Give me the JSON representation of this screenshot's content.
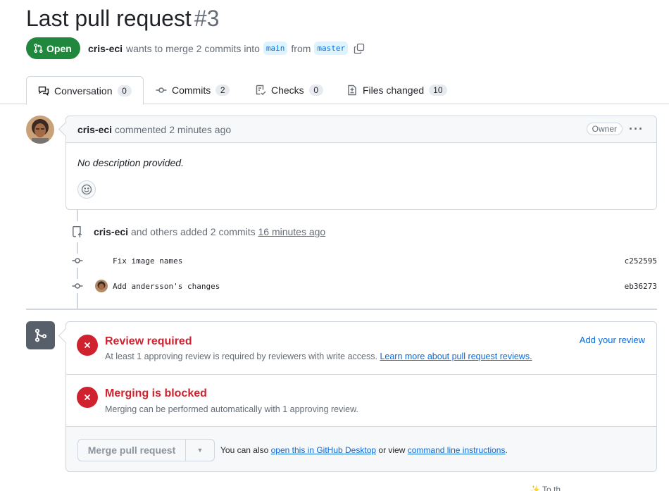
{
  "pr": {
    "title": "Last pull request",
    "number": "#3",
    "state": "Open",
    "author": "cris-eci",
    "merge_text": "wants to merge 2 commits into",
    "base_branch": "main",
    "from_text": "from",
    "head_branch": "master"
  },
  "tabs": [
    {
      "label": "Conversation",
      "count": "0",
      "icon": "comment-discussion-icon"
    },
    {
      "label": "Commits",
      "count": "2",
      "icon": "git-commit-icon"
    },
    {
      "label": "Checks",
      "count": "0",
      "icon": "checklist-icon"
    },
    {
      "label": "Files changed",
      "count": "10",
      "icon": "file-diff-icon"
    }
  ],
  "comment": {
    "author": "cris-eci",
    "action": "commented",
    "time": "2 minutes ago",
    "badge": "Owner",
    "menu": "···",
    "body": "No description provided."
  },
  "event": {
    "author": "cris-eci",
    "text": "and others added 2 commits",
    "time": "16 minutes ago"
  },
  "commits": [
    {
      "message": "Fix image names",
      "sha": "c252595"
    },
    {
      "message": "Add andersson's changes",
      "sha": "eb36273"
    }
  ],
  "merge": {
    "review_title": "Review required",
    "review_sub": "At least 1 approving review is required by reviewers with write access.",
    "review_link": "Learn more about pull request reviews.",
    "add_review": "Add your review",
    "blocked_title": "Merging is blocked",
    "blocked_sub": "Merging can be performed automatically with 1 approving review.",
    "button": "Merge pull request",
    "note_prefix": "You can also",
    "note_link1": "open this in GitHub Desktop",
    "note_mid": "or view",
    "note_link2": "command line instructions",
    "note_suffix": "."
  },
  "footer_fragment": "✨ To th",
  "colors": {
    "open": "#1f883d",
    "danger": "#cf222e",
    "link": "#0969da"
  }
}
